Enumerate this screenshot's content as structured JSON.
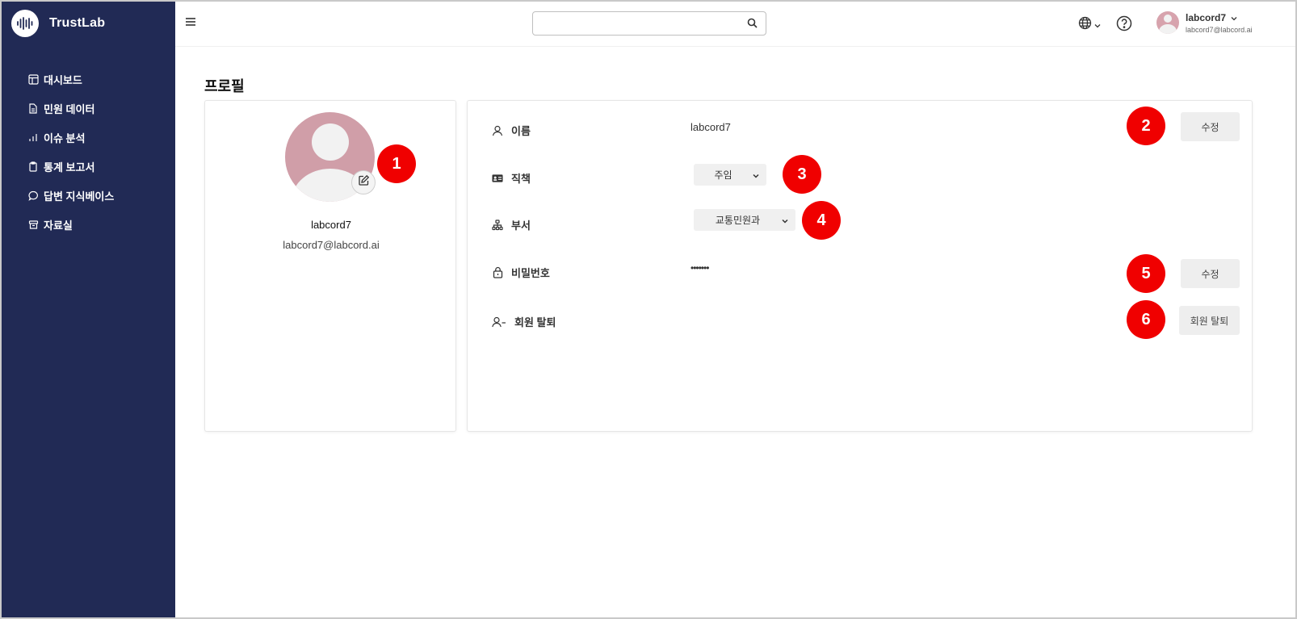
{
  "brand": {
    "name": "TrustLab"
  },
  "sidebar": {
    "items": [
      {
        "label": "대시보드",
        "icon": "dashboard-icon"
      },
      {
        "label": "민원 데이터",
        "icon": "document-icon"
      },
      {
        "label": "이슈 분석",
        "icon": "bar-chart-icon"
      },
      {
        "label": "통계 보고서",
        "icon": "clipboard-icon"
      },
      {
        "label": "답변 지식베이스",
        "icon": "chat-bubble-icon"
      },
      {
        "label": "자료실",
        "icon": "archive-icon"
      }
    ]
  },
  "header": {
    "search": {
      "placeholder": "",
      "value": ""
    },
    "user": {
      "name": "labcord7",
      "email": "labcord7@labcord.ai"
    }
  },
  "page": {
    "title": "프로필"
  },
  "profile_card": {
    "name": "labcord7",
    "email": "labcord7@labcord.ai"
  },
  "details": {
    "name": {
      "label": "이름",
      "value": "labcord7",
      "button": "수정"
    },
    "position": {
      "label": "직책",
      "selected": "주임"
    },
    "department": {
      "label": "부서",
      "selected": "교통민원과"
    },
    "password": {
      "label": "비밀번호",
      "value": "•••••••",
      "button": "수정"
    },
    "withdraw": {
      "label": "회원 탈퇴",
      "button": "회원 탈퇴"
    }
  },
  "annotations": [
    "1",
    "2",
    "3",
    "4",
    "5",
    "6"
  ],
  "colors": {
    "sidebar_bg": "#212a55",
    "badge": "#f00000",
    "avatar": "#d09ea8",
    "button_bg": "#eeeeee"
  }
}
